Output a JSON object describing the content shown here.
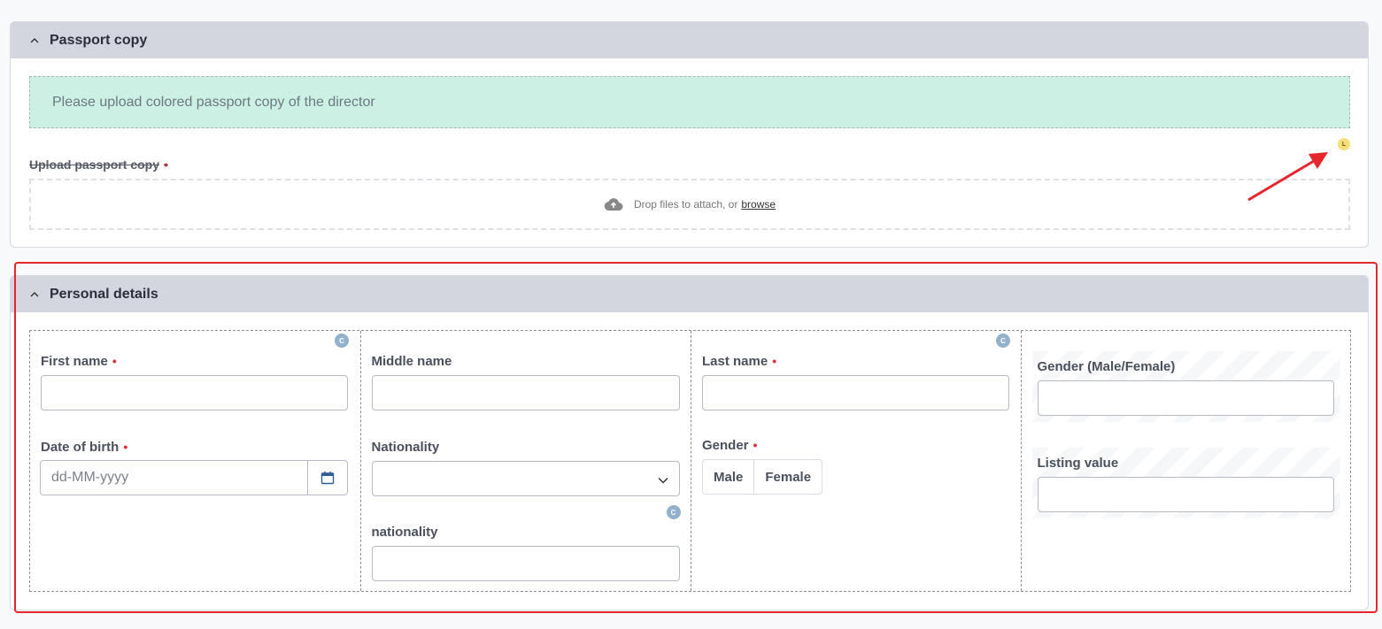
{
  "passport_section": {
    "title": "Passport copy",
    "info": "Please upload colored passport copy of the director",
    "upload_label": "Upload passport copy",
    "required_mark": "•",
    "drop_text": "Drop files to attach, or",
    "browse_text": "browse",
    "badge": "L"
  },
  "personal_section": {
    "title": "Personal details",
    "first_name_label": "First name",
    "middle_name_label": "Middle name",
    "last_name_label": "Last name",
    "dob_label": "Date of birth",
    "dob_placeholder": "dd-MM-yyyy",
    "nationality_label": "Nationality",
    "nationality2_label": "nationality",
    "gender_label": "Gender",
    "gender_options": [
      "Male",
      "Female"
    ],
    "gender_mf_label": "Gender (Male/Female)",
    "listing_value_label": "Listing value",
    "required_mark": "•",
    "c_badge": "C"
  },
  "colors": {
    "accent_required": "#e0303a",
    "info_bg": "#cdf0e4",
    "header_bg": "#d3d6de",
    "annotation": "#e5262d"
  }
}
